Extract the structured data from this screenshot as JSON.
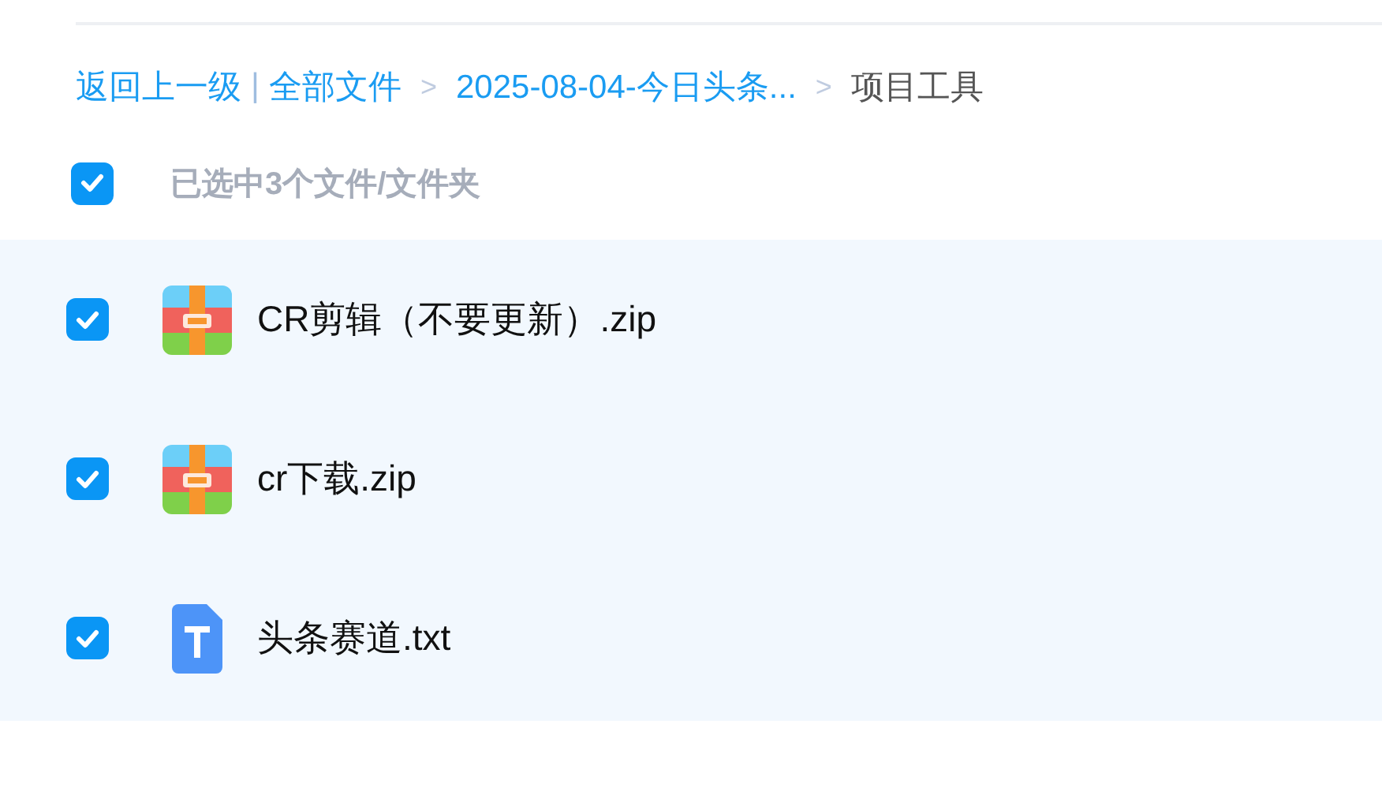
{
  "breadcrumb": {
    "back": "返回上一级",
    "separator": "|",
    "path": [
      {
        "label": "全部文件",
        "current": false
      },
      {
        "label": "2025-08-04-今日头条...",
        "current": false
      },
      {
        "label": "项目工具",
        "current": true
      }
    ],
    "arrow": ">"
  },
  "select_all": {
    "checked": true,
    "label": "已选中3个文件/文件夹"
  },
  "files": [
    {
      "name": "CR剪辑（不要更新）.zip",
      "kind": "zip",
      "checked": true
    },
    {
      "name": "cr下载.zip",
      "kind": "zip",
      "checked": true
    },
    {
      "name": "头条赛道.txt",
      "kind": "txt",
      "checked": true
    }
  ]
}
